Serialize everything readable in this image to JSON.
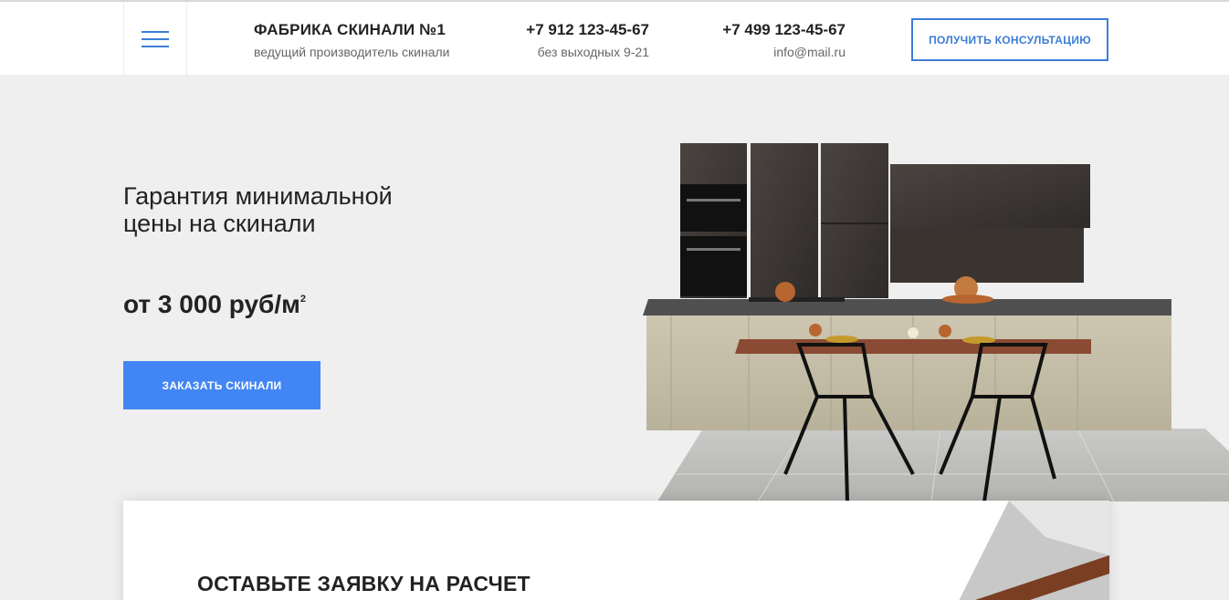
{
  "header": {
    "brand_title": "ФАБРИКА СКИНАЛИ №1",
    "brand_subtitle": "ведущий производитель скинали",
    "phone1": "+7 912 123-45-67",
    "phone1_note": "без выходных 9-21",
    "phone2": "+7 499 123-45-67",
    "email": "info@mail.ru",
    "consult_button": "ПОЛУЧИТЬ КОНСУЛЬТАЦИЮ"
  },
  "hero": {
    "title": "Гарантия минимальной цены на скинали",
    "price": "от 3 000 руб/м",
    "price_sup": "2",
    "order_button": "ЗАКАЗАТЬ СКИНАЛИ"
  },
  "form": {
    "title": "ОСТАВЬТЕ ЗАЯВКУ НА РАСЧЕТ"
  },
  "icons": {
    "menu": "hamburger-menu-icon"
  },
  "colors": {
    "accent": "#3d7dd6",
    "button_primary": "#4285f4",
    "hero_background": "#efefef"
  }
}
